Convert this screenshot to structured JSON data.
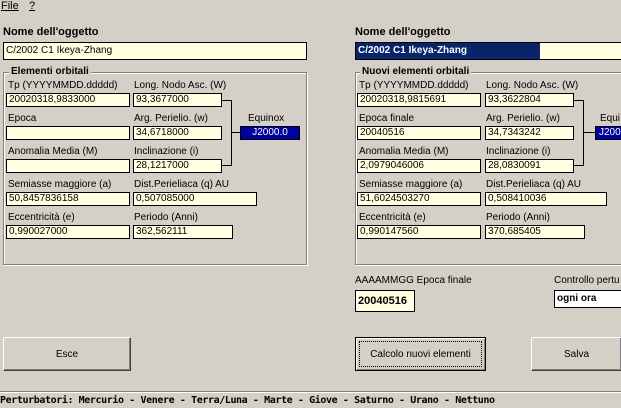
{
  "menu": {
    "file": "File",
    "help": "?"
  },
  "left": {
    "title": "Nome dell'oggetto",
    "object_name": "C/2002 C1 Ikeya-Zhang",
    "group_title": "Elementi orbitali",
    "tp_label": "Tp (YYYYMMDD.ddddd)",
    "tp_value": "20020318,9833000",
    "node_label": "Long. Nodo Asc.  (W)",
    "node_value": "93,3677000",
    "epoch_label": "Epoca",
    "epoch_value": "",
    "perihelion_label": "Arg. Perielio.  (w)",
    "perihelion_value": "34,6718000",
    "equinox_label": "Equinox",
    "equinox_value": "J2000.0",
    "anomaly_label": "Anomalia Media      (M)",
    "anomaly_value": "",
    "incl_label": "Inclinazione        (i)",
    "incl_value": "28,1217000",
    "semiaxis_label": "Semiasse maggiore (a)",
    "semiaxis_value": "50,8457836158",
    "perihelion_dist_label": "Dist.Perieliaca  (q) AU",
    "perihelion_dist_value": "0,507085000",
    "ecc_label": "Eccentricità           (e)",
    "ecc_value": "0,990027000",
    "period_label": "Periodo (Anni)",
    "period_value": "362,562111"
  },
  "right": {
    "title": "Nome dell'oggetto",
    "object_name": "C/2002 C1 Ikeya-Zhang",
    "group_title": "Nuovi elementi orbitali",
    "tp_label": "Tp (YYYYMMDD.ddddd)",
    "tp_value": "20020318,9815691",
    "node_label": "Long. Nodo Asc.  (W)",
    "node_value": "93,3622804",
    "epoch_label": "Epoca finale",
    "epoch_value": "20040516",
    "perihelion_label": "Arg. Perielio.  (w)",
    "perihelion_value": "34,7343242",
    "equinox_label": "Equi",
    "equinox_value": "J200",
    "anomaly_label": "Anomalia Media      (M)",
    "anomaly_value": "2,0979046006",
    "incl_label": "Inclinazione        (i)",
    "incl_value": "28,0830091",
    "semiaxis_label": "Semiasse maggiore (a)",
    "semiaxis_value": "51,6024503270",
    "perihelion_dist_label": "Dist.Perieliaca  (q) AU",
    "perihelion_dist_value": "0,508410036",
    "ecc_label": "Eccentricità           (e)",
    "ecc_value": "0,990147560",
    "period_label": "Periodo (Anni)",
    "period_value": "370,685405"
  },
  "final_epoch": {
    "label": "AAAAMMGG Epoca finale",
    "value": "20040516"
  },
  "control": {
    "label": "Controllo pertu",
    "value": "ogni ora"
  },
  "buttons": {
    "exit": "Esce",
    "compute": "Calcolo nuovi elementi",
    "save": "Salva"
  },
  "footer": "Perturbatori: Mercurio - Venere - Terra/Luna - Marte - Giove - Saturno - Urano - Nettuno"
}
